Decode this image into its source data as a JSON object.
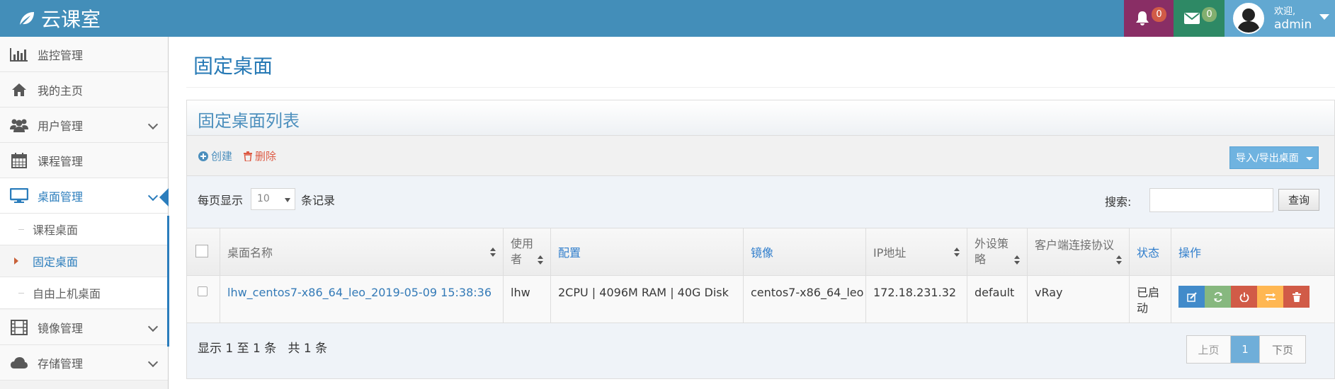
{
  "header": {
    "brand": "云课室",
    "notifications_count": "0",
    "messages_count": "0",
    "welcome": "欢迎,",
    "username": "admin"
  },
  "sidebar": {
    "items": [
      {
        "label": "监控管理",
        "icon": "bar-chart-icon"
      },
      {
        "label": "我的主页",
        "icon": "home-icon"
      },
      {
        "label": "用户管理",
        "icon": "users-icon"
      },
      {
        "label": "课程管理",
        "icon": "calendar-icon"
      },
      {
        "label": "桌面管理",
        "icon": "desktop-icon"
      },
      {
        "label": "镜像管理",
        "icon": "film-icon"
      },
      {
        "label": "存储管理",
        "icon": "cloud-icon"
      }
    ],
    "subitems": [
      {
        "label": "课程桌面"
      },
      {
        "label": "固定桌面"
      },
      {
        "label": "自由上机桌面"
      }
    ]
  },
  "page": {
    "title": "固定桌面",
    "panel_title": "固定桌面列表",
    "create_label": "创建",
    "delete_label": "删除",
    "import_export_label": "导入/导出桌面",
    "page_size_prefix": "每页显示",
    "page_size_value": "10",
    "page_size_suffix": "条记录",
    "search_label": "搜索:",
    "query_label": "查询"
  },
  "table": {
    "columns": [
      "桌面名称",
      "使用者",
      "配置",
      "镜像",
      "IP地址",
      "外设策略",
      "客户端连接协议",
      "状态",
      "操作"
    ],
    "rows": [
      {
        "name": "lhw_centos7-x86_64_leo_2019-05-09 15:38:36",
        "user": "lhw",
        "config": "2CPU | 4096M RAM | 40G Disk",
        "image": "centos7-x86_64_leo",
        "ip": "172.18.231.32",
        "policy": "default",
        "protocol": "vRay",
        "status": "已启动"
      }
    ]
  },
  "footer": {
    "info": "显示 1 至 1 条   共 1 条",
    "prev": "上页",
    "current": "1",
    "next": "下页"
  },
  "colors": {
    "topbar": "#438eb9",
    "accent": "#2b7dbc",
    "op_edit": "#428bca",
    "op_refresh": "#87b87f",
    "op_power": "#d15b47",
    "op_swap": "#ffb752",
    "op_delete": "#d15b47"
  }
}
